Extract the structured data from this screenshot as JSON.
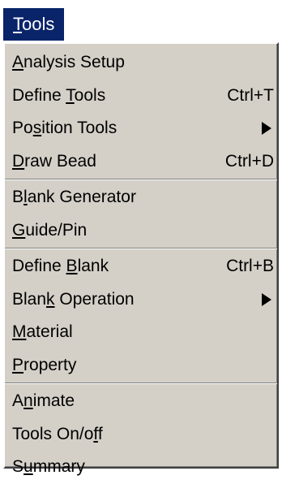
{
  "menubar": {
    "title": "Tools",
    "title_mnemonic_first": "T",
    "title_rest": "ools"
  },
  "menu": {
    "groups": [
      {
        "items": [
          {
            "label_pre": "",
            "label_u": "A",
            "label_post": "nalysis Setup",
            "shortcut": "",
            "submenu": false
          },
          {
            "label_pre": "Define ",
            "label_u": "T",
            "label_post": "ools",
            "shortcut": "Ctrl+T",
            "submenu": false
          },
          {
            "label_pre": "Po",
            "label_u": "s",
            "label_post": "ition Tools",
            "shortcut": "",
            "submenu": true
          },
          {
            "label_pre": "",
            "label_u": "D",
            "label_post": "raw Bead",
            "shortcut": "Ctrl+D",
            "submenu": false
          }
        ]
      },
      {
        "items": [
          {
            "label_pre": "B",
            "label_u": "l",
            "label_post": "ank Generator",
            "shortcut": "",
            "submenu": false
          },
          {
            "label_pre": "",
            "label_u": "G",
            "label_post": "uide/Pin",
            "shortcut": "",
            "submenu": false
          }
        ]
      },
      {
        "items": [
          {
            "label_pre": "Define ",
            "label_u": "B",
            "label_post": "lank",
            "shortcut": "Ctrl+B",
            "submenu": false
          },
          {
            "label_pre": "Blan",
            "label_u": "k",
            "label_post": " Operation",
            "shortcut": "",
            "submenu": true
          },
          {
            "label_pre": "",
            "label_u": "M",
            "label_post": "aterial",
            "shortcut": "",
            "submenu": false
          },
          {
            "label_pre": "",
            "label_u": "P",
            "label_post": "roperty",
            "shortcut": "",
            "submenu": false
          }
        ]
      },
      {
        "items": [
          {
            "label_pre": "A",
            "label_u": "n",
            "label_post": "imate",
            "shortcut": "",
            "submenu": false
          },
          {
            "label_pre": "Tools On/o",
            "label_u": "f",
            "label_post": "f",
            "shortcut": "",
            "submenu": false
          },
          {
            "label_pre": "S",
            "label_u": "u",
            "label_post": "mmary",
            "shortcut": "",
            "submenu": false
          }
        ]
      }
    ]
  },
  "colors": {
    "title_bg": "#0a246a",
    "title_fg": "#ffffff",
    "menu_bg": "#d4d0c8",
    "text": "#000000"
  },
  "icons": {
    "submenu": "submenu-arrow-icon"
  }
}
